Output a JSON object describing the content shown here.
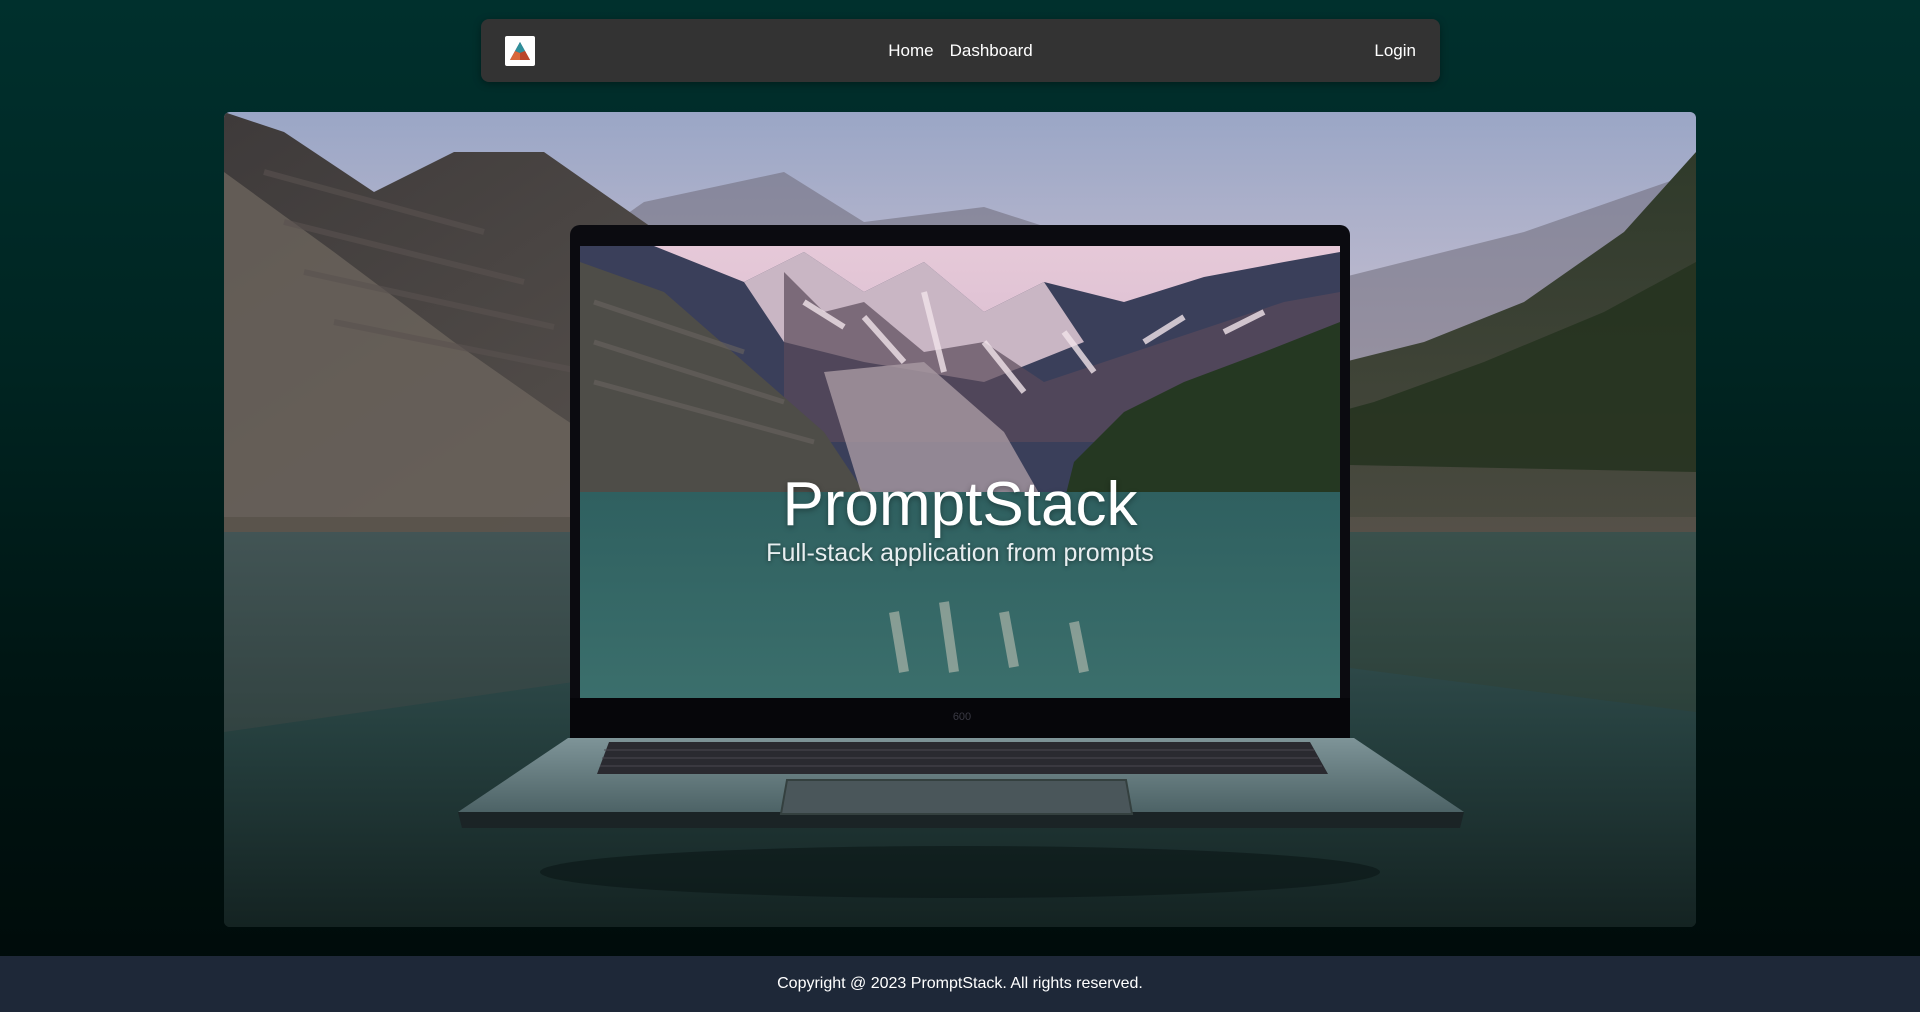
{
  "nav": {
    "logo_icon": "mountain-logo-icon",
    "links": [
      {
        "label": "Home"
      },
      {
        "label": "Dashboard"
      }
    ],
    "login_label": "Login"
  },
  "hero": {
    "title": "PromptStack",
    "subtitle": "Full-stack application from prompts",
    "image": "laptop-on-lake-with-mountains"
  },
  "footer": {
    "copyright": "Copyright @ 2023 PromptStack. All rights reserved."
  },
  "colors": {
    "background_top": "#00302d",
    "background_bottom": "#000a09",
    "navbar": "#333333",
    "footer": "#1e2838",
    "text": "#ffffff"
  }
}
